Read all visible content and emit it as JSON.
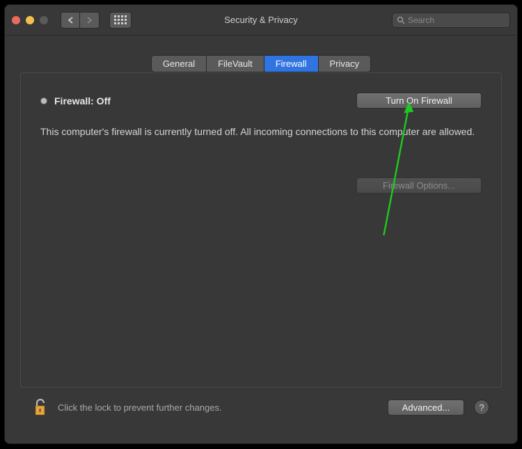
{
  "window": {
    "title": "Security & Privacy"
  },
  "search": {
    "placeholder": "Search"
  },
  "tabs": {
    "general": "General",
    "filevault": "FileVault",
    "firewall": "Firewall",
    "privacy": "Privacy",
    "active": "firewall"
  },
  "firewall": {
    "status_label": "Firewall: Off",
    "turn_on_label": "Turn On Firewall",
    "description": "This computer's firewall is currently turned off. All incoming connections to this computer are allowed.",
    "options_label": "Firewall Options..."
  },
  "footer": {
    "lock_hint": "Click the lock to prevent further changes.",
    "advanced_label": "Advanced...",
    "help_label": "?"
  },
  "colors": {
    "accent": "#2f74e0",
    "annotation_arrow": "#00d000"
  }
}
